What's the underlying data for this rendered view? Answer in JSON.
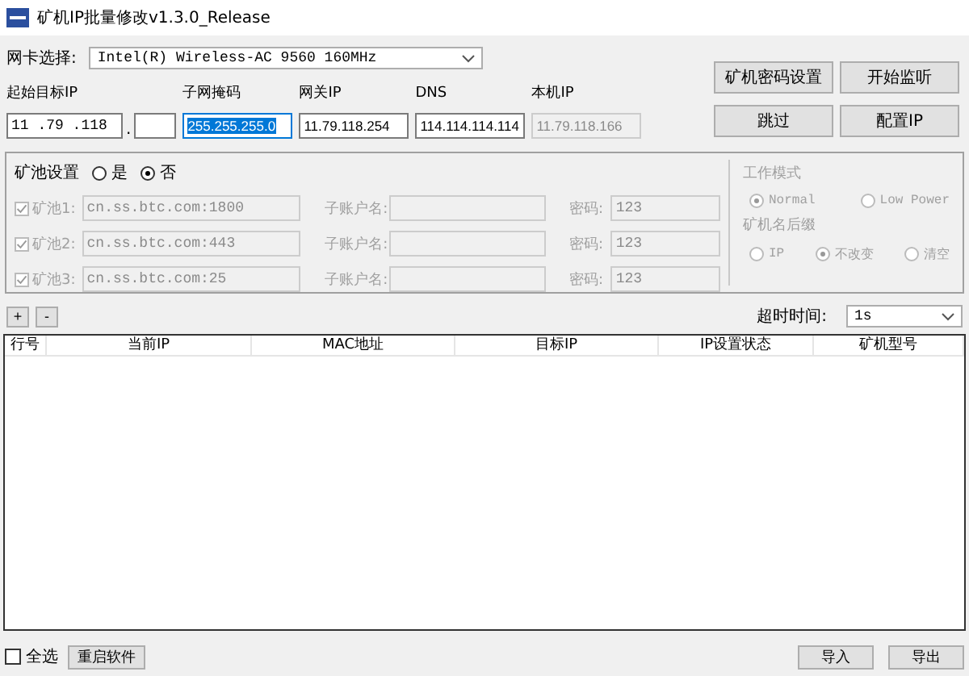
{
  "window": {
    "title": "矿机IP批量修改v1.3.0_Release"
  },
  "nic": {
    "label": "网卡选择:",
    "value": "Intel(R) Wireless-AC 9560 160MHz"
  },
  "start_ip": {
    "label": "起始目标IP",
    "value": "11 .79 .118",
    "separator": "."
  },
  "ip_fields": [
    {
      "label": "子网掩码",
      "value": "255.255.255.0",
      "selected": true,
      "disabled": false
    },
    {
      "label": "网关IP",
      "value": "11.79.118.254",
      "selected": false,
      "disabled": false
    },
    {
      "label": "DNS",
      "value": "114.114.114.114",
      "selected": false,
      "disabled": false
    },
    {
      "label": "本机IP",
      "value": "11.79.118.166",
      "selected": false,
      "disabled": true
    }
  ],
  "action_buttons": [
    "矿机密码设置",
    "开始监听",
    "跳过",
    "配置IP"
  ],
  "pool_setting": {
    "label": "矿池设置",
    "options": [
      {
        "label": "是",
        "selected": false
      },
      {
        "label": "否",
        "selected": true
      }
    ]
  },
  "pools": [
    {
      "label": "矿池1:",
      "checked": true,
      "disabled": true,
      "url": "cn.ss.btc.com:1800",
      "sub_label": "子账户名:",
      "password_label": "密码:",
      "password": "123"
    },
    {
      "label": "矿池2:",
      "checked": true,
      "disabled": true,
      "url": "cn.ss.btc.com:443",
      "sub_label": "子账户名:",
      "password_label": "密码:",
      "password": "123"
    },
    {
      "label": "矿池3:",
      "checked": true,
      "disabled": true,
      "url": "cn.ss.btc.com:25",
      "sub_label": "子账户名:",
      "password_label": "密码:",
      "password": "123"
    }
  ],
  "mode_groups": [
    {
      "title": "工作模式",
      "disabled": true,
      "options": [
        {
          "label": "Normal",
          "selected": true
        },
        {
          "label": "Low Power",
          "selected": false
        }
      ]
    },
    {
      "title": "矿机名后缀",
      "disabled": true,
      "options": [
        {
          "label": "IP",
          "selected": false
        },
        {
          "label": "不改变",
          "selected": true
        },
        {
          "label": "清空",
          "selected": false
        }
      ]
    }
  ],
  "toolbar": {
    "buttons": [
      "+",
      "-"
    ],
    "timeout_label": "超时时间:",
    "timeout_value": "1s"
  },
  "table": {
    "columns": [
      "行号",
      "当前IP",
      "MAC地址",
      "目标IP",
      "IP设置状态",
      "矿机型号"
    ]
  },
  "footer": {
    "select_all": {
      "label": "全选",
      "checked": false
    },
    "restart": "重启软件",
    "buttons": [
      "导入",
      "导出"
    ]
  }
}
